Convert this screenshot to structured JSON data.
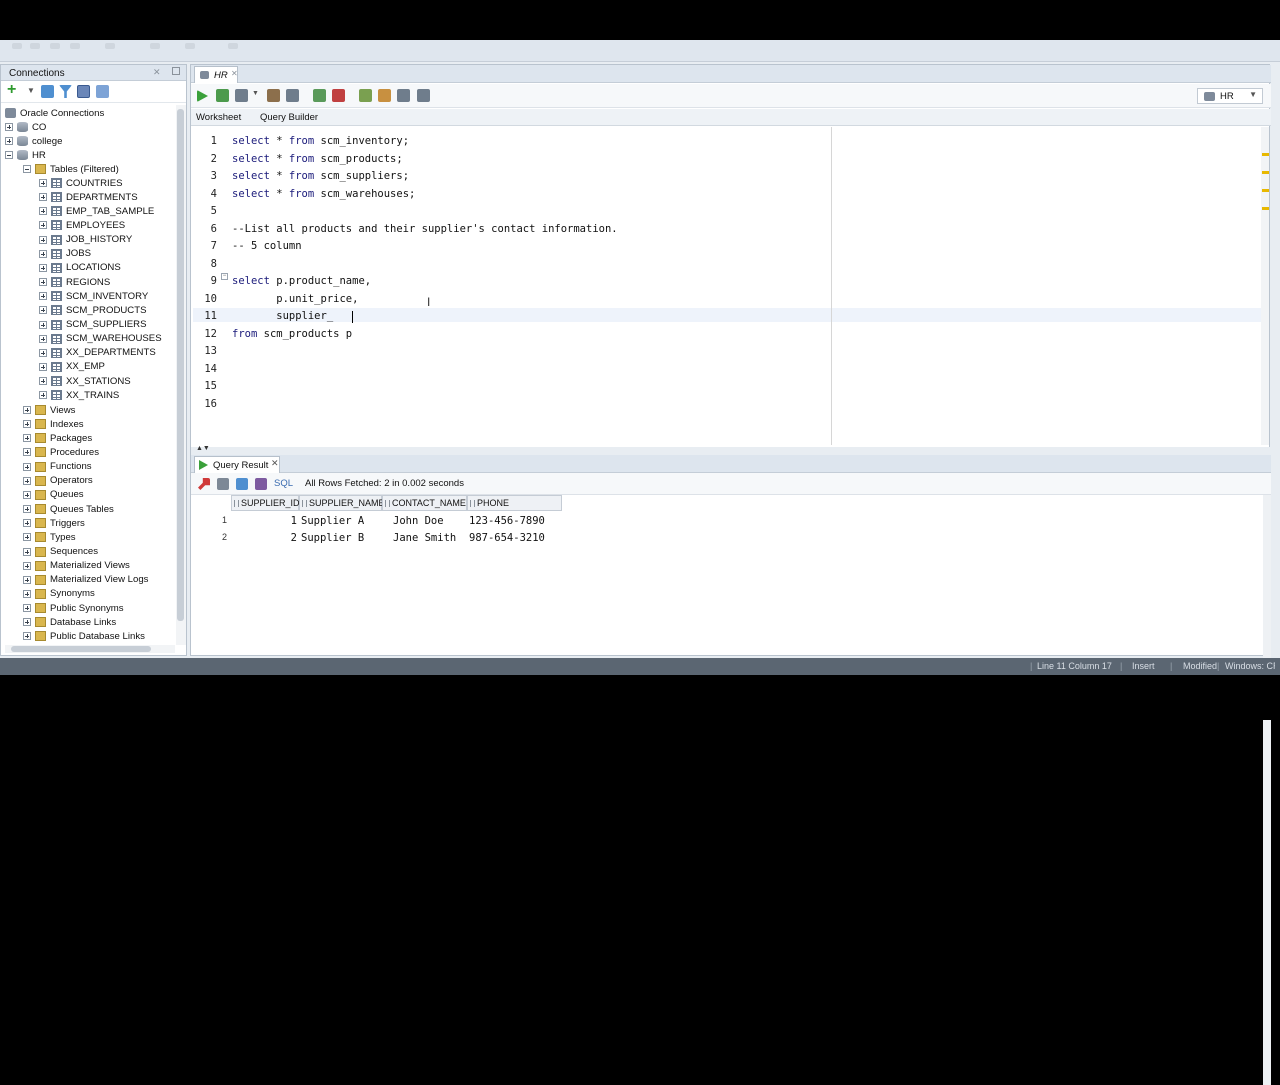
{
  "connections_panel": {
    "title": "Connections",
    "root": "Oracle Connections",
    "connections": [
      "CO",
      "college",
      "HR"
    ],
    "tables_node": "Tables (Filtered)",
    "tables": [
      "COUNTRIES",
      "DEPARTMENTS",
      "EMP_TAB_SAMPLE",
      "EMPLOYEES",
      "JOB_HISTORY",
      "JOBS",
      "LOCATIONS",
      "REGIONS",
      "SCM_INVENTORY",
      "SCM_PRODUCTS",
      "SCM_SUPPLIERS",
      "SCM_WAREHOUSES",
      "XX_DEPARTMENTS",
      "XX_EMP",
      "XX_STATIONS",
      "XX_TRAINS"
    ],
    "object_types": [
      "Views",
      "Indexes",
      "Packages",
      "Procedures",
      "Functions",
      "Operators",
      "Queues",
      "Queues Tables",
      "Triggers",
      "Types",
      "Sequences",
      "Materialized Views",
      "Materialized View Logs",
      "Synonyms",
      "Public Synonyms",
      "Database Links",
      "Public Database Links"
    ]
  },
  "editor": {
    "tab_label": "HR",
    "connection_selector": "HR",
    "subtabs": [
      "Worksheet",
      "Query Builder"
    ],
    "line_numbers": [
      "1",
      "2",
      "3",
      "4",
      "5",
      "6",
      "7",
      "8",
      "9",
      "10",
      "11",
      "12",
      "13",
      "14",
      "15",
      "16"
    ],
    "lines": [
      "select * from scm_inventory;",
      "select * from scm_products;",
      "select * from scm_suppliers;",
      "select * from scm_warehouses;",
      "",
      "--List all products and their supplier's contact information.",
      "-- 5 column",
      "",
      "select p.product_name,",
      "       p.unit_price,",
      "       supplier_",
      "from scm_products p",
      "",
      "",
      "",
      ""
    ]
  },
  "result": {
    "tab_label": "Query Result",
    "sql_label": "SQL",
    "status": "All Rows Fetched: 2 in 0.002 seconds",
    "columns": [
      "SUPPLIER_ID",
      "SUPPLIER_NAME",
      "CONTACT_NAME",
      "PHONE"
    ],
    "rows": [
      {
        "n": "1",
        "id": "1",
        "name": "Supplier A",
        "contact": "John Doe",
        "phone": "123-456-7890"
      },
      {
        "n": "2",
        "id": "2",
        "name": "Supplier B",
        "contact": "Jane Smith",
        "phone": "987-654-3210"
      }
    ]
  },
  "status_bar": {
    "position": "Line 11 Column 17",
    "mode": "Insert",
    "modified": "Modified",
    "eol": "Windows: CR"
  },
  "colors": {
    "keyword": "#1a1a7a",
    "comment": "#8c8c8c",
    "run_green": "#3aa03a",
    "status_bar": "#5b6672"
  }
}
